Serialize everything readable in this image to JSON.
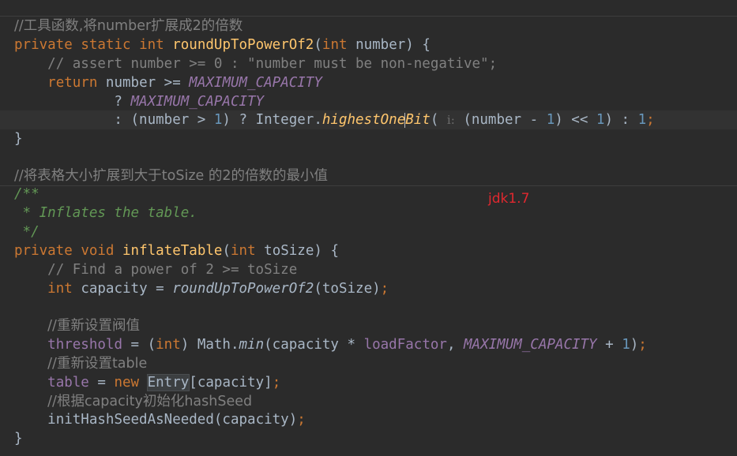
{
  "editor": {
    "comment_util": "//工具函数,将number扩展成2的倍数",
    "kw_private": "private",
    "kw_static": "static",
    "kw_int": "int",
    "kw_return": "return",
    "kw_void": "void",
    "kw_new": "new",
    "fn_roundUp": "roundUpToPowerOf2",
    "param_number": "number",
    "comment_assert": "// assert number >= 0 : ",
    "string_nonneg": "\"number must be non-negative\"",
    "comment_semicolon": ";",
    "const_max": "MAXIMUM_CAPACITY",
    "integer_class": "Integer.",
    "method_highest": "highestOneBit",
    "hint_i": "i:",
    "comment_table": "//将表格大小扩展到大于toSize 的2的倍数的最小值",
    "javadoc_open": "/**",
    "javadoc_body": " * Inflates the table.",
    "javadoc_close": " */",
    "fn_inflate": "inflateTable",
    "param_toSize": "toSize",
    "comment_find": "// Find a power of 2 >= toSize",
    "var_capacity": "capacity",
    "comment_reset": "//重新设置阀值",
    "field_threshold": "threshold",
    "math_min": "min",
    "field_loadFactor": "loadFactor",
    "comment_reset_table": "//重新设置table",
    "field_table": "table",
    "class_entry": "Entry",
    "comment_hashseed": "//根据capacity初始化hashSeed",
    "fn_initHash": "initHashSeedAsNeeded",
    "label": "jdk1.7"
  }
}
